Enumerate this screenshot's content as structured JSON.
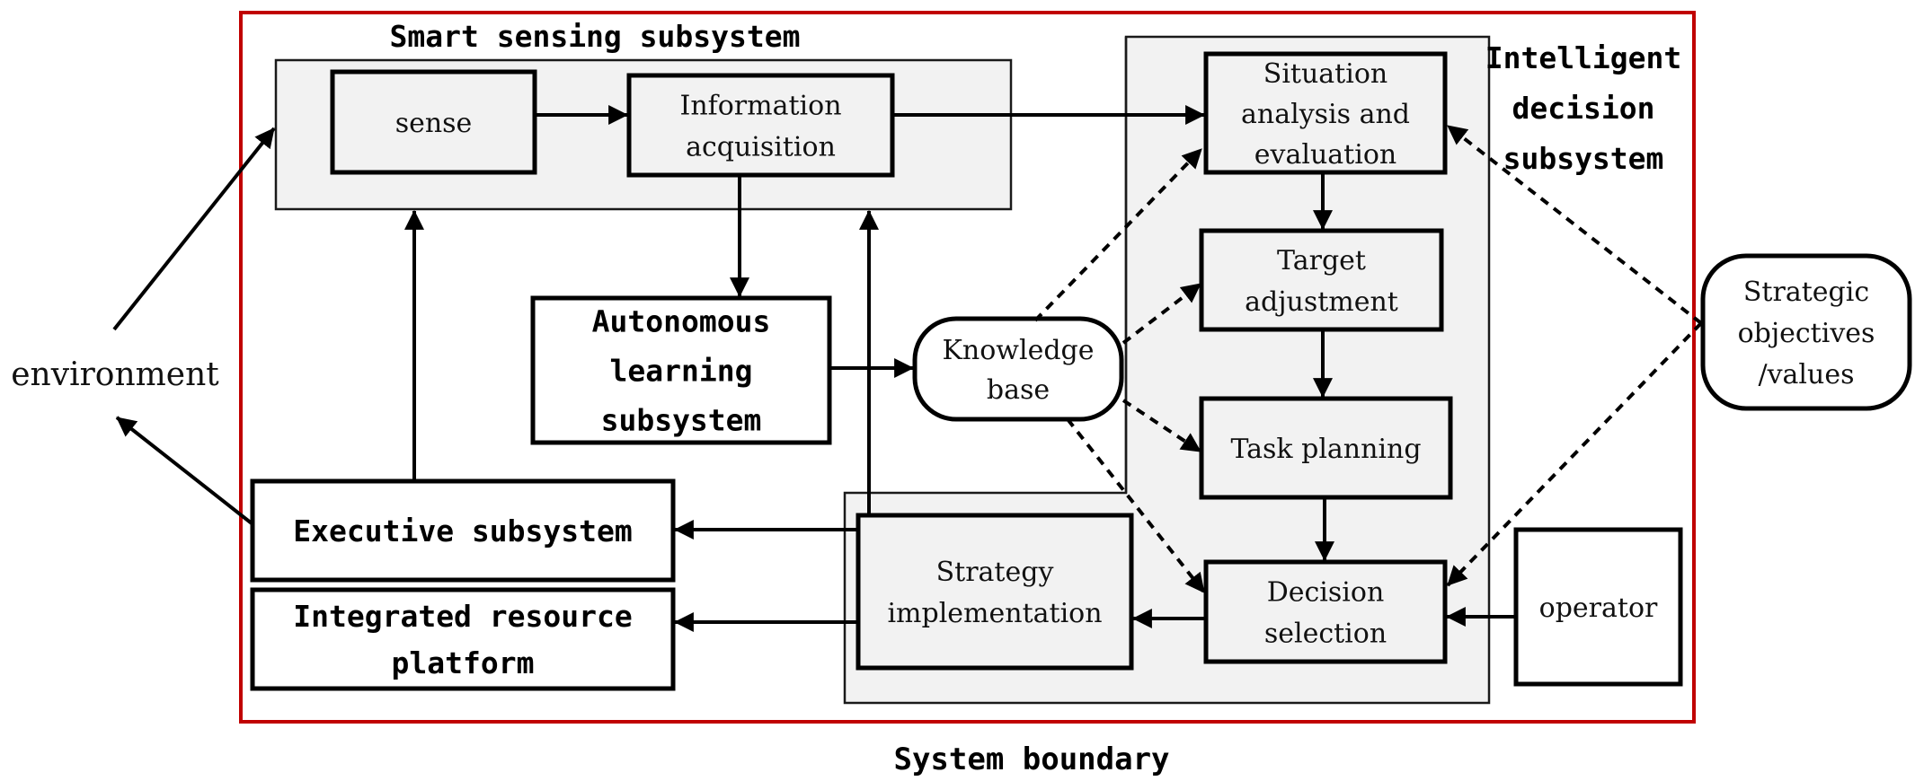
{
  "diagram": {
    "title_boundary": "System boundary",
    "environment": "environment",
    "colors": {
      "boundary": "#c00000",
      "subsystem_fill": "#f2f2f2",
      "stroke": "#000000"
    },
    "groups": {
      "smart_sensing": {
        "title": "Smart sensing subsystem"
      },
      "intelligent_decision": {
        "title_lines": [
          "Intelligent",
          "decision",
          "subsystem"
        ]
      },
      "strategy_region": {
        "title": ""
      }
    },
    "nodes": {
      "sense": {
        "lines": [
          "sense"
        ]
      },
      "information_acquisition": {
        "lines": [
          "Information",
          "acquisition"
        ]
      },
      "autonomous_learning": {
        "lines": [
          "Autonomous",
          "learning",
          "subsystem"
        ]
      },
      "knowledge_base": {
        "lines": [
          "Knowledge",
          "base"
        ]
      },
      "situation_analysis": {
        "lines": [
          "Situation",
          "analysis and",
          "evaluation"
        ]
      },
      "target_adjustment": {
        "lines": [
          "Target",
          "adjustment"
        ]
      },
      "task_planning": {
        "lines": [
          "Task planning"
        ]
      },
      "decision_selection": {
        "lines": [
          "Decision",
          "selection"
        ]
      },
      "strategy_implementation": {
        "lines": [
          "Strategy",
          "implementation"
        ]
      },
      "executive_subsystem": {
        "lines": [
          "Executive subsystem"
        ]
      },
      "integrated_resource_platform": {
        "lines": [
          "Integrated resource",
          "platform"
        ]
      },
      "operator": {
        "lines": [
          "operator"
        ]
      },
      "strategic_objectives": {
        "lines": [
          "Strategic",
          "objectives",
          "/values"
        ]
      }
    },
    "edges": [
      {
        "from": "environment",
        "to": "smart_sensing",
        "style": "solid"
      },
      {
        "from": "executive_subsystem",
        "to": "environment",
        "style": "solid"
      },
      {
        "from": "sense",
        "to": "information_acquisition",
        "style": "solid"
      },
      {
        "from": "information_acquisition",
        "to": "situation_analysis",
        "style": "solid"
      },
      {
        "from": "information_acquisition",
        "to": "autonomous_learning",
        "style": "solid"
      },
      {
        "from": "autonomous_learning",
        "to": "knowledge_base",
        "style": "solid"
      },
      {
        "from": "executive_subsystem",
        "to": "smart_sensing",
        "style": "solid"
      },
      {
        "from": "strategy_implementation",
        "to": "smart_sensing",
        "style": "solid"
      },
      {
        "from": "situation_analysis",
        "to": "target_adjustment",
        "style": "solid"
      },
      {
        "from": "target_adjustment",
        "to": "task_planning",
        "style": "solid"
      },
      {
        "from": "task_planning",
        "to": "decision_selection",
        "style": "solid"
      },
      {
        "from": "decision_selection",
        "to": "strategy_implementation",
        "style": "solid"
      },
      {
        "from": "operator",
        "to": "decision_selection",
        "style": "solid"
      },
      {
        "from": "strategy_implementation",
        "to": "executive_subsystem",
        "style": "solid"
      },
      {
        "from": "strategy_implementation",
        "to": "integrated_resource_platform",
        "style": "solid"
      },
      {
        "from": "knowledge_base",
        "to": "situation_analysis",
        "style": "dashed"
      },
      {
        "from": "knowledge_base",
        "to": "target_adjustment",
        "style": "dashed"
      },
      {
        "from": "knowledge_base",
        "to": "task_planning",
        "style": "dashed"
      },
      {
        "from": "knowledge_base",
        "to": "decision_selection",
        "style": "dashed"
      },
      {
        "from": "strategic_objectives",
        "to": "situation_analysis",
        "style": "dashed"
      },
      {
        "from": "strategic_objectives",
        "to": "decision_selection",
        "style": "dashed"
      }
    ]
  }
}
